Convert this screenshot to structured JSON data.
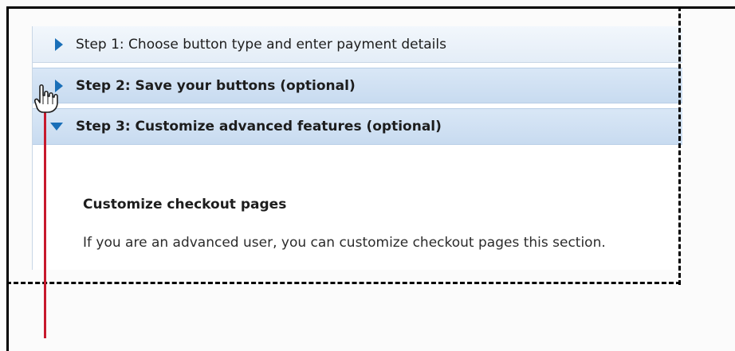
{
  "steps": [
    {
      "label": "Step 1: Choose button type and enter payment details",
      "state": "collapsed"
    },
    {
      "label": "Step 2: Save your buttons (optional)",
      "state": "collapsed"
    },
    {
      "label": "Step 3: Customize advanced features (optional)",
      "state": "expanded"
    }
  ],
  "content": {
    "title": "Customize checkout pages",
    "body": "If you are an advanced user, you can customize checkout pages this section."
  },
  "icons": {
    "collapsed": "triangle-right-icon",
    "expanded": "triangle-down-icon",
    "cursor": "hand-pointer-icon"
  },
  "colors": {
    "accent": "#1a6fb8",
    "annotation_line": "#c7192d"
  }
}
